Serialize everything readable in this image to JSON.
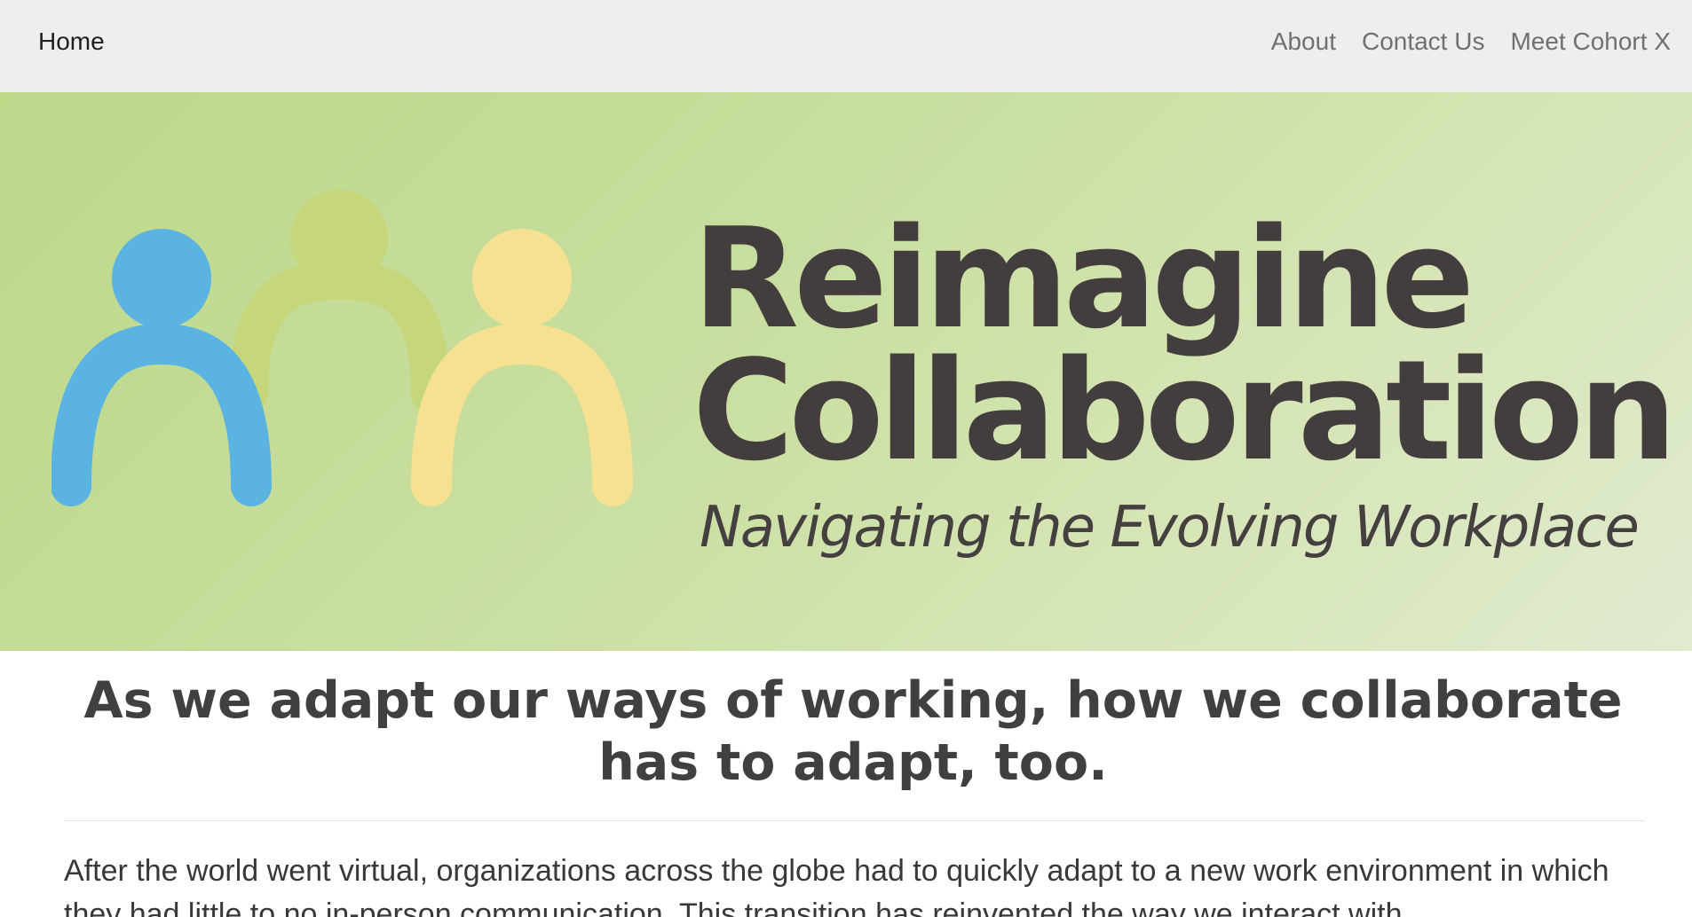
{
  "nav": {
    "home": "Home",
    "items": [
      {
        "label": "About"
      },
      {
        "label": "Contact Us"
      },
      {
        "label": "Meet Cohort X"
      }
    ]
  },
  "hero": {
    "title_line1": "Reimagine",
    "title_line2": "Collaboration",
    "tagline": "Navigating the Evolving Workplace",
    "logo_colors": {
      "blue": "#5bb3e1",
      "green": "#c6d77b",
      "yellow": "#f6e091"
    }
  },
  "main": {
    "heading": "As we adapt our ways of working, how we collaborate has to adapt, too.",
    "paragraph": "After the world went virtual, organizations across the globe had to quickly adapt to a new work environment in which they had little to no in-person communication. This transition has reinvented the way we interact with"
  },
  "icons": {
    "logo": "three-people-logo"
  }
}
